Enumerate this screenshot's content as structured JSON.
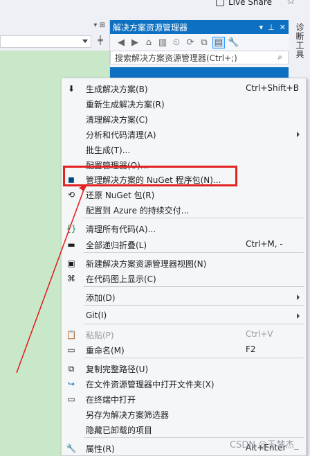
{
  "top": {
    "live_share": "Live Share"
  },
  "solution_explorer": {
    "title": "解决方案资源管理器",
    "search_placeholder": "搜索解决方案资源管理器(Ctrl+;)"
  },
  "right_tab_label": "诊断工具",
  "context_menu": {
    "items": [
      {
        "label": "生成解决方案(B)",
        "shortcut": "Ctrl+Shift+B",
        "icon": "build-icon",
        "submenu": false,
        "disabled": false
      },
      {
        "label": "重新生成解决方案(R)",
        "shortcut": "",
        "icon": "",
        "submenu": false,
        "disabled": false
      },
      {
        "label": "清理解决方案(C)",
        "shortcut": "",
        "icon": "",
        "submenu": false,
        "disabled": false
      },
      {
        "label": "分析和代码清理(A)",
        "shortcut": "",
        "icon": "",
        "submenu": true,
        "disabled": false
      },
      {
        "label": "批生成(T)...",
        "shortcut": "",
        "icon": "",
        "submenu": false,
        "disabled": false
      },
      {
        "label": "配置管理器(O)...",
        "shortcut": "",
        "icon": "",
        "submenu": false,
        "disabled": false
      },
      {
        "label": "管理解决方案的 NuGet 程序包(N)...",
        "shortcut": "",
        "icon": "nuget-icon",
        "submenu": false,
        "disabled": false
      },
      {
        "label": "还原 NuGet 包(R)",
        "shortcut": "",
        "icon": "restore-icon",
        "submenu": false,
        "disabled": false
      },
      {
        "label": "配置到 Azure 的持续交付...",
        "shortcut": "",
        "icon": "",
        "submenu": false,
        "disabled": false
      },
      {
        "label": "清理所有代码(A)...",
        "shortcut": "",
        "icon": "code-cleanup-icon",
        "submenu": false,
        "disabled": false
      },
      {
        "label": "全部递归折叠(L)",
        "shortcut": "Ctrl+M, -",
        "icon": "collapse-icon",
        "submenu": false,
        "disabled": false
      },
      {
        "label": "新建解决方案资源管理器视图(N)",
        "shortcut": "",
        "icon": "new-view-icon",
        "submenu": false,
        "disabled": false
      },
      {
        "label": "在代码图上显示(C)",
        "shortcut": "",
        "icon": "code-map-icon",
        "submenu": false,
        "disabled": false
      },
      {
        "label": "添加(D)",
        "shortcut": "",
        "icon": "",
        "submenu": true,
        "disabled": false
      },
      {
        "label": "Git(I)",
        "shortcut": "",
        "icon": "",
        "submenu": true,
        "disabled": false
      },
      {
        "label": "粘贴(P)",
        "shortcut": "Ctrl+V",
        "icon": "paste-icon",
        "submenu": false,
        "disabled": true
      },
      {
        "label": "重命名(M)",
        "shortcut": "F2",
        "icon": "rename-icon",
        "submenu": false,
        "disabled": false
      },
      {
        "label": "复制完整路径(U)",
        "shortcut": "",
        "icon": "copy-path-icon",
        "submenu": false,
        "disabled": false
      },
      {
        "label": "在文件资源管理器中打开文件夹(X)",
        "shortcut": "",
        "icon": "open-folder-icon",
        "submenu": false,
        "disabled": false
      },
      {
        "label": "在终端中打开",
        "shortcut": "",
        "icon": "terminal-icon",
        "submenu": false,
        "disabled": false
      },
      {
        "label": "另存为解决方案筛选器",
        "shortcut": "",
        "icon": "",
        "submenu": false,
        "disabled": false
      },
      {
        "label": "隐藏已卸载的项目",
        "shortcut": "",
        "icon": "",
        "submenu": false,
        "disabled": false
      },
      {
        "label": "属性(R)",
        "shortcut": "Alt+Enter",
        "icon": "properties-icon",
        "submenu": false,
        "disabled": false
      }
    ]
  },
  "watermark": "CSDN @王梦杰_",
  "colors": {
    "accent": "#0e70c0",
    "highlight_border": "#e32222",
    "editor_background": "#c9e8c9"
  }
}
